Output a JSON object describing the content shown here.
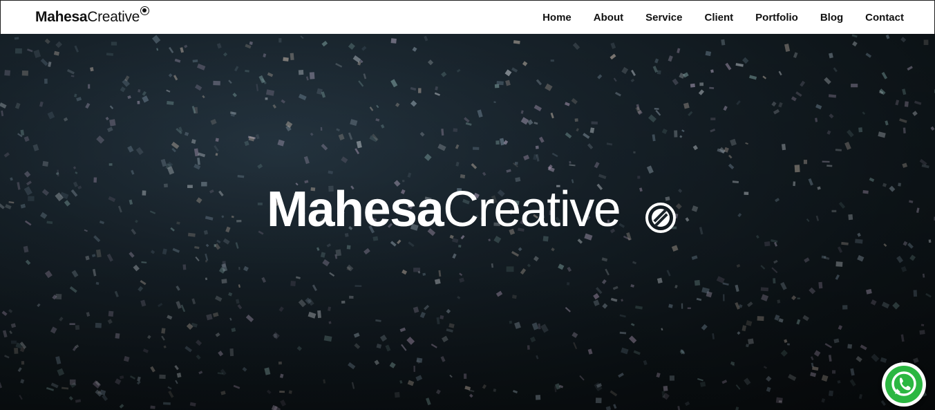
{
  "brand": {
    "name_bold": "Mahesa",
    "name_light": "Creative"
  },
  "nav": {
    "items": [
      {
        "label": "Home"
      },
      {
        "label": "About"
      },
      {
        "label": "Service"
      },
      {
        "label": "Client"
      },
      {
        "label": "Portfolio"
      },
      {
        "label": "Blog"
      },
      {
        "label": "Contact"
      }
    ]
  },
  "hero": {
    "logo_bold": "Mahesa",
    "logo_light": "Creative",
    "background": "dark confetti photo",
    "overlay_color": "#0d1418"
  },
  "floating": {
    "whatsapp_icon": "whatsapp-icon",
    "whatsapp_color": "#2bb741"
  }
}
